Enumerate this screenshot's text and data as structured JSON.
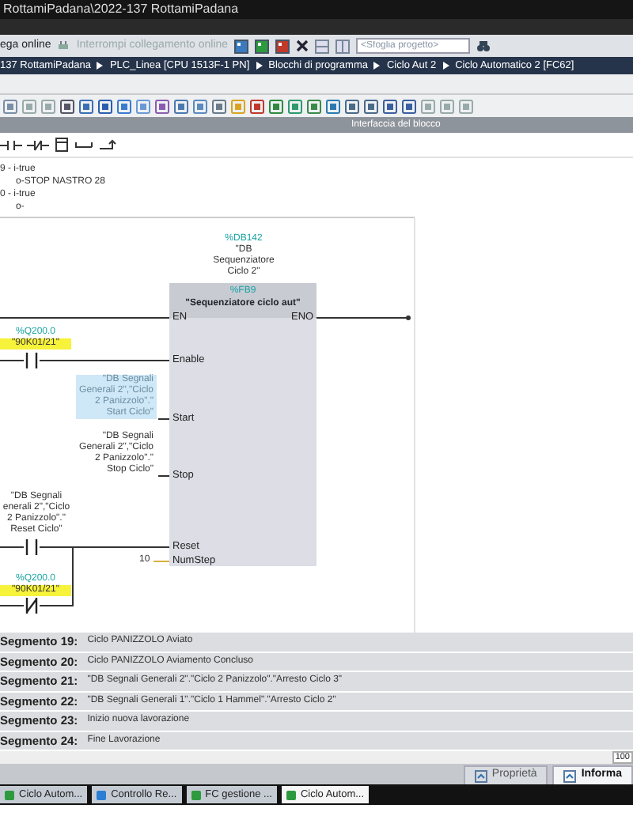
{
  "window": {
    "title": "RottamiPadana\\2022-137 RottamiPadana"
  },
  "toolbar": {
    "items": [
      {
        "label": "ega online",
        "disabled": false
      },
      {
        "label": "Interrompi collegamento online",
        "disabled": true
      }
    ],
    "search": {
      "placeholder": "<Sfoglia progetto>"
    }
  },
  "breadcrumb": [
    "137 RottamiPadana",
    "PLC_Linea [CPU 1513F-1 PN]",
    "Blocchi di programma",
    "Ciclo Aut 2",
    "Ciclo Automatico 2 [FC62]"
  ],
  "interface_bar": {
    "title": "Interfaccia del blocco"
  },
  "previous_network": [
    "9 - i-true",
    "o-STOP NASTRO 28",
    "0 - i-true",
    "o-"
  ],
  "network": {
    "instance": {
      "address": "%DB142",
      "lines": [
        "\"DB",
        "Sequenziatore",
        "Ciclo 2\""
      ]
    },
    "block": {
      "address": "%FB9",
      "name": "\"Sequenziatore ciclo aut\""
    },
    "outputs": [
      {
        "pin": "ENO"
      }
    ],
    "inputs": [
      {
        "pin": "EN"
      },
      {
        "pin": "Enable",
        "operand": {
          "kind": "contact",
          "negated": false,
          "address": "%Q200.0",
          "lines": [
            "\"90K01/21\""
          ],
          "highlighted": true
        }
      },
      {
        "pin": "Start",
        "operand": {
          "kind": "tag",
          "lines": [
            "\"DB Segnali",
            "Generali 2\",\"Ciclo",
            "2 Panizzolo\".\"",
            "Start Ciclo\""
          ],
          "selected": true
        }
      },
      {
        "pin": "Stop",
        "operand": {
          "kind": "tag",
          "lines": [
            "\"DB Segnali",
            "Generali 2\",\"Ciclo",
            "2 Panizzolo\".\"",
            "Stop Ciclo\""
          ],
          "selected": false
        }
      },
      {
        "pin": "Reset",
        "operand": {
          "kind": "contact",
          "negated": false,
          "lines": [
            "\"DB Segnali",
            "enerali 2\",\"Ciclo",
            "2 Panizzolo\".\"",
            "Reset Ciclo\""
          ],
          "highlighted": false
        },
        "branch": {
          "kind": "contact",
          "negated": true,
          "address": "%Q200.0",
          "lines": [
            "\"90K01/21\""
          ],
          "highlighted": true
        }
      },
      {
        "pin": "NumStep",
        "operand": {
          "kind": "value",
          "text": "10"
        }
      }
    ]
  },
  "segments": [
    {
      "number": "Segmento 19:",
      "comment": "Ciclo PANIZZOLO Aviato"
    },
    {
      "number": "Segmento 20:",
      "comment": "Ciclo PANIZZOLO Aviamento Concluso"
    },
    {
      "number": "Segmento 21:",
      "comment": "\"DB Segnali Generali 2\".\"Ciclo 2 Panizzolo\".\"Arresto Ciclo 3\""
    },
    {
      "number": "Segmento 22:",
      "comment": "\"DB Segnali Generali 1\".\"Ciclo 1 Hammel\".\"Arresto Ciclo 2\""
    },
    {
      "number": "Segmento 23:",
      "comment": "Inizio nuova lavorazione"
    },
    {
      "number": "Segmento 24:",
      "comment": "Fine Lavorazione"
    }
  ],
  "zoom": "100",
  "bottom_tabs": [
    {
      "label": "Proprietà",
      "selected": false
    },
    {
      "label": "Informa",
      "selected": true
    }
  ],
  "taskbar": [
    {
      "label": "Ciclo Autom...",
      "color": "#2e9a3e",
      "selected": false
    },
    {
      "label": "Controllo Re...",
      "color": "#2a7fd4",
      "selected": false
    },
    {
      "label": "FC gestione ...",
      "color": "#2e9a3e",
      "selected": false
    },
    {
      "label": "Ciclo Autom...",
      "color": "#2e9a3e",
      "selected": true
    }
  ]
}
